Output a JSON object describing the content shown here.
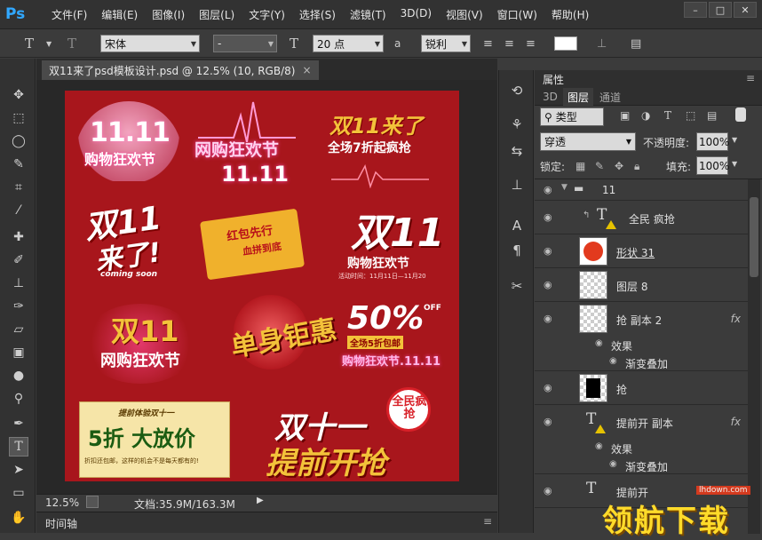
{
  "app": {
    "logo": "Ps"
  },
  "menu": [
    "文件(F)",
    "编辑(E)",
    "图像(I)",
    "图层(L)",
    "文字(Y)",
    "选择(S)",
    "滤镜(T)",
    "3D(D)",
    "视图(V)",
    "窗口(W)",
    "帮助(H)"
  ],
  "window_controls": {
    "minimize": "–",
    "restore": "□",
    "close": "✕"
  },
  "options": {
    "font_family": "宋体",
    "font_style": "-",
    "font_size": "20 点",
    "antialias": "锐利",
    "text_tool_icon": "T",
    "orient_icon": "T",
    "size_icon": "T",
    "aa_icon": "a"
  },
  "document": {
    "tab_title": "双11来了psd模板设计.psd @ 12.5% (10, RGB/8)",
    "close": "×",
    "zoom": "12.5%",
    "doc_size": "文档:35.9M/163.3M",
    "timeline": "时间轴"
  },
  "artwork": {
    "a1_top": "11.11",
    "a1_bottom": "购物狂欢节",
    "a2_top": "网购狂欢节",
    "a2_bottom": "11.11",
    "a3_top": "双11来了",
    "a3_bottom": "全场7折起疯抢",
    "a4_top": "双11",
    "a4_bottom": "来了!",
    "a4_en": "coming soon",
    "a5_top": "红包先行",
    "a5_bottom": "血拼到底",
    "a6_top": "双11",
    "a6_bottom": "购物狂欢节",
    "a6_date": "活动时间：11月11日—11月20",
    "a7_top": "双11",
    "a7_bottom": "网购狂欢节",
    "a8_main": "单身钜惠",
    "a9_pct": "50%",
    "a9_off": "OFF",
    "a9_sub": "全场5折包邮",
    "a9_bottom": "购物狂欢节.11.11",
    "a10_top": "提前体验双十一",
    "a10_main": "5折 大放价",
    "a10_bottom": "折扣还包邮，这样的机会不是每天都有的!",
    "a11_badge": "全民疯抢",
    "a11_top": "双十一",
    "a11_bottom": "提前开抢"
  },
  "panel": {
    "properties_tab": "属性",
    "tabs": [
      "3D",
      "图层",
      "通道"
    ],
    "filter_kind": "类型",
    "blend_mode": "穿透",
    "opacity_label": "不透明度:",
    "opacity": "100%",
    "lock_label": "锁定:",
    "fill_label": "填充:",
    "fill": "100%"
  },
  "layers": [
    {
      "name": "11",
      "kind": "group"
    },
    {
      "name": "全民 疯抢",
      "kind": "text"
    },
    {
      "name": "形状 31",
      "kind": "shape"
    },
    {
      "name": "图层 8",
      "kind": "pixel"
    },
    {
      "name": "抢 副本 2",
      "kind": "pixel",
      "fx": "fx"
    },
    {
      "name": "效果",
      "kind": "effect"
    },
    {
      "name": "渐变叠加",
      "kind": "effect"
    },
    {
      "name": "抢",
      "kind": "pixel"
    },
    {
      "name": "提前开 副本",
      "kind": "text",
      "fx": "fx"
    },
    {
      "name": "效果",
      "kind": "effect"
    },
    {
      "name": "渐变叠加",
      "kind": "effect"
    },
    {
      "name": "提前开",
      "kind": "text"
    }
  ],
  "watermark": {
    "text": "领航下载",
    "url": "lhdown.com"
  },
  "colors": {
    "canvas": "#a8161c",
    "gold": "#f3c23a",
    "pink": "#ff5fb0"
  }
}
